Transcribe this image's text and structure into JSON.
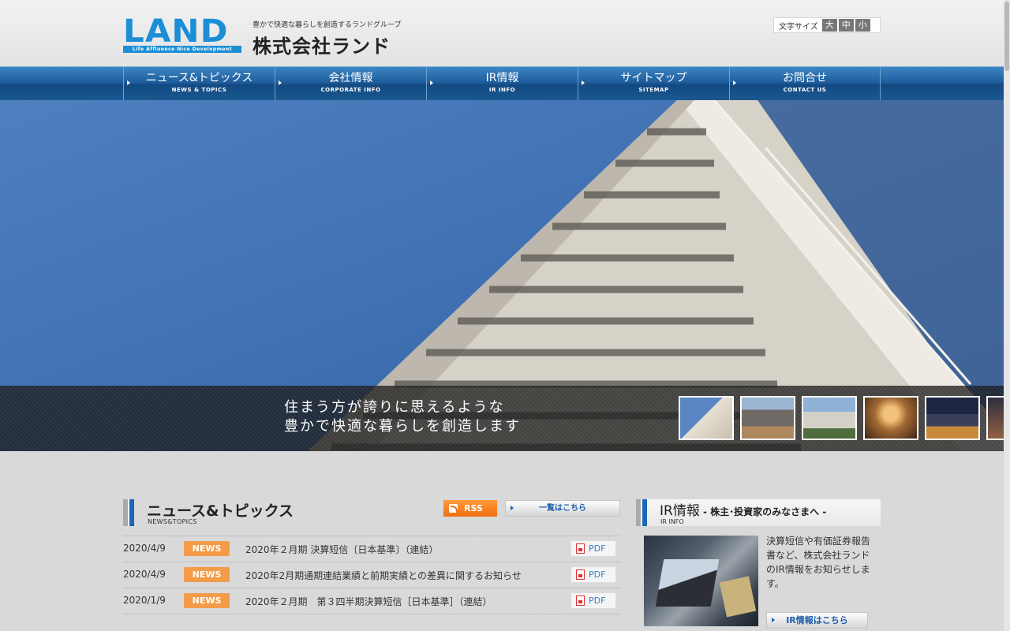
{
  "header": {
    "logo_word": "LAND",
    "logo_sub": "Life Affluence Nice Development",
    "tagline": "豊かで快適な暮らしを創造するランドグループ",
    "company_name": "株式会社ランド",
    "font_size_label": "文字サイズ",
    "font_sizes": [
      "大",
      "中",
      "小"
    ]
  },
  "nav": [
    {
      "ja": "ニュース&トピックス",
      "en": "NEWS & TOPICS"
    },
    {
      "ja": "会社情報",
      "en": "CORPORATE INFO"
    },
    {
      "ja": "IR情報",
      "en": "IR INFO"
    },
    {
      "ja": "サイトマップ",
      "en": "SITEMAP"
    },
    {
      "ja": "お問合せ",
      "en": "CONTACT US"
    }
  ],
  "hero": {
    "copy_line1": "住まう方が誇りに思えるような",
    "copy_line2": "豊かで快適な暮らしを創造します"
  },
  "news": {
    "title": "ニュース&トピックス",
    "title_en": "NEWS&TOPICS",
    "rss_label": "RSS",
    "list_label": "一覧はこちら",
    "items": [
      {
        "date": "2020/4/9",
        "badge": "NEWS",
        "title": "2020年２月期 決算短信〔日本基準〕（連結）",
        "link": "PDF"
      },
      {
        "date": "2020/4/9",
        "badge": "NEWS",
        "title": "2020年2月期通期連結業績と前期実績との差異に関するお知らせ",
        "link": "PDF"
      },
      {
        "date": "2020/1/9",
        "badge": "NEWS",
        "title": "2020年２月期　第３四半期決算短信［日本基準］（連結）",
        "link": "PDF"
      }
    ]
  },
  "ir": {
    "title": "IR情報",
    "subtitle": " - 株主･投資家のみなさまへ -",
    "title_en": "IR INFO",
    "text": "決算短信や有価証券報告書など、株式会社ランドのIR情報をお知らせします。",
    "button_label": "IR情報はこちら"
  }
}
